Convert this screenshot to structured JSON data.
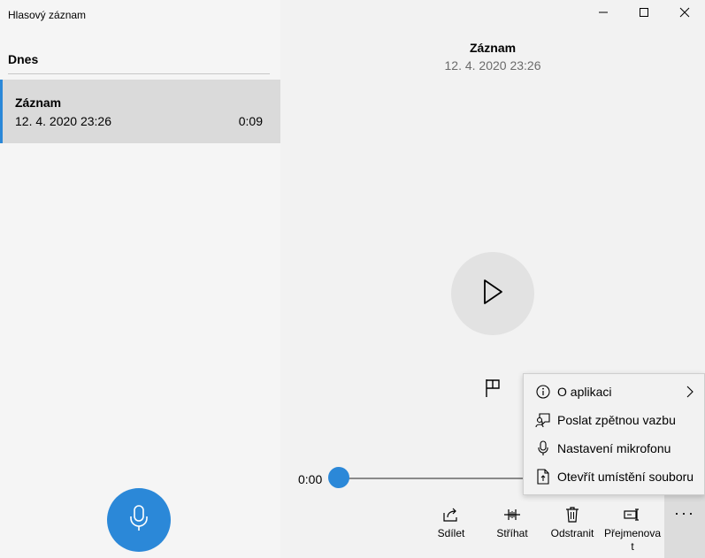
{
  "window": {
    "title": "Hlasový záznam"
  },
  "recordings_list": {
    "section": "Dnes",
    "items": [
      {
        "name": "Záznam",
        "date": "12. 4. 2020 23:26",
        "duration": "0:09"
      }
    ]
  },
  "player": {
    "title": "Záznam",
    "date": "12. 4. 2020 23:26",
    "current_time": "0:00",
    "progress": 0
  },
  "toolbar": {
    "share": "Sdílet",
    "trim": "Stříhat",
    "delete": "Odstranit",
    "rename_line1": "Přejmenova",
    "rename_line2": "t",
    "more": "···"
  },
  "context_menu": {
    "about": "O aplikaci",
    "feedback": "Poslat zpětnou vazbu",
    "mic_settings": "Nastavení mikrofonu",
    "open_location": "Otevřít umístění souboru"
  },
  "colors": {
    "accent": "#2b88d8",
    "panel_selected": "#dadada",
    "background": "#f2f2f2"
  },
  "icons": {
    "minimize": "minimize-icon",
    "maximize": "maximize-icon",
    "close": "close-icon",
    "play": "play-icon",
    "flag": "flag-icon",
    "mic": "microphone-icon",
    "share": "share-icon",
    "trim": "trim-icon",
    "delete": "trash-icon",
    "rename": "rename-icon",
    "info": "info-icon",
    "feedback": "feedback-icon",
    "file": "file-icon",
    "chevron": "chevron-right-icon"
  }
}
